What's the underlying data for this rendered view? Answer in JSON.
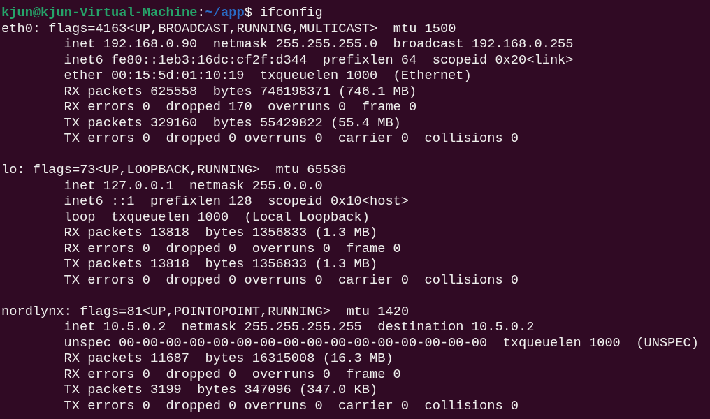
{
  "terminal": {
    "prompt": {
      "user_host": "kjun@kjun-Virtual-Machine",
      "separator": ":",
      "path": "~/app",
      "command": "$ ifconfig"
    },
    "interfaces": [
      {
        "header": "eth0: flags=4163<UP,BROADCAST,RUNNING,MULTICAST>  mtu 1500",
        "lines": [
          "inet 192.168.0.90  netmask 255.255.255.0  broadcast 192.168.0.255",
          "inet6 fe80::1eb3:16dc:cf2f:d344  prefixlen 64  scopeid 0x20<link>",
          "ether 00:15:5d:01:10:19  txqueuelen 1000  (Ethernet)",
          "RX packets 625558  bytes 746198371 (746.1 MB)",
          "RX errors 0  dropped 170  overruns 0  frame 0",
          "TX packets 329160  bytes 55429822 (55.4 MB)",
          "TX errors 0  dropped 0 overruns 0  carrier 0  collisions 0"
        ]
      },
      {
        "header": "lo: flags=73<UP,LOOPBACK,RUNNING>  mtu 65536",
        "lines": [
          "inet 127.0.0.1  netmask 255.0.0.0",
          "inet6 ::1  prefixlen 128  scopeid 0x10<host>",
          "loop  txqueuelen 1000  (Local Loopback)",
          "RX packets 13818  bytes 1356833 (1.3 MB)",
          "RX errors 0  dropped 0  overruns 0  frame 0",
          "TX packets 13818  bytes 1356833 (1.3 MB)",
          "TX errors 0  dropped 0 overruns 0  carrier 0  collisions 0"
        ]
      },
      {
        "header": "nordlynx: flags=81<UP,POINTOPOINT,RUNNING>  mtu 1420",
        "lines": [
          "inet 10.5.0.2  netmask 255.255.255.255  destination 10.5.0.2",
          "unspec 00-00-00-00-00-00-00-00-00-00-00-00-00-00-00-00  txqueuelen 1000  (UNSPEC)",
          "RX packets 11687  bytes 16315008 (16.3 MB)",
          "RX errors 0  dropped 0  overruns 0  frame 0",
          "TX packets 3199  bytes 347096 (347.0 KB)",
          "TX errors 0  dropped 0 overruns 0  carrier 0  collisions 0"
        ]
      }
    ]
  }
}
